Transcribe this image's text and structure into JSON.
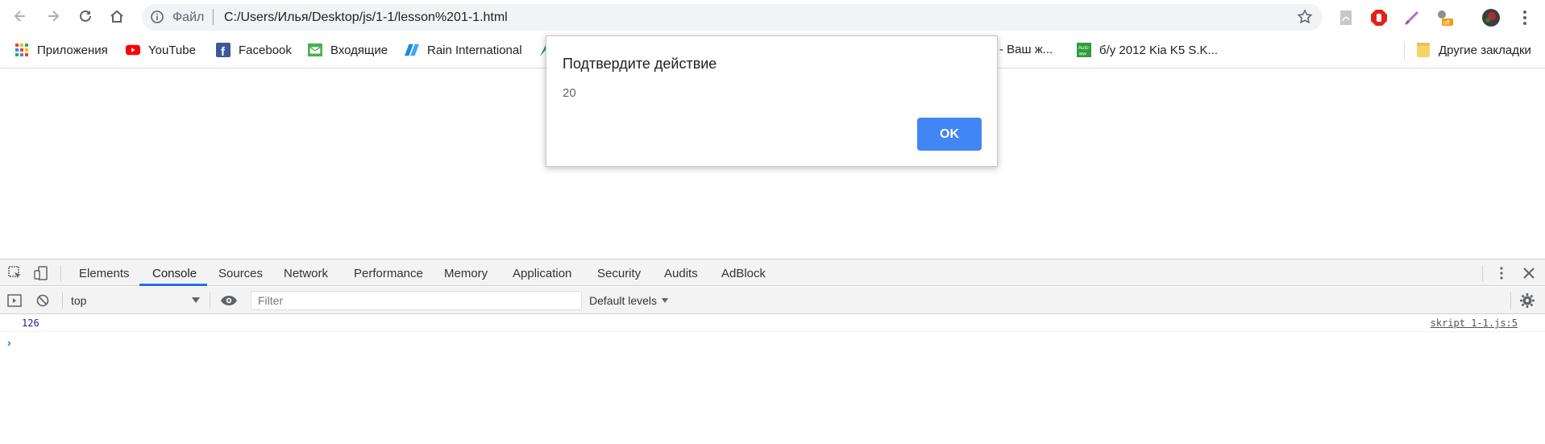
{
  "window": {
    "address": {
      "scheme_label": "Файл",
      "url": "C:/Users/Илья/Desktop/js/1-1/lesson%201-1.html"
    }
  },
  "bookmarks": [
    {
      "label": "Приложения",
      "icon": "apps-grid-icon"
    },
    {
      "label": "YouTube",
      "icon": "youtube-icon"
    },
    {
      "label": "Facebook",
      "icon": "facebook-icon"
    },
    {
      "label": "Входящие",
      "icon": "mail-icon"
    },
    {
      "label": "Rain International",
      "icon": "rain-icon"
    },
    {
      "label": "- Ваш ж...",
      "icon": ""
    },
    {
      "label": "б/у 2012 Kia K5 S.K...",
      "icon": "auto-icon"
    },
    {
      "label": "Другие закладки",
      "icon": "folder-icon"
    }
  ],
  "dialog": {
    "title": "Подтвердите действие",
    "message": "20",
    "ok_label": "OK"
  },
  "devtools": {
    "tabs": [
      "Elements",
      "Console",
      "Sources",
      "Network",
      "Performance",
      "Memory",
      "Application",
      "Security",
      "Audits",
      "AdBlock"
    ],
    "active_tab": "Console",
    "context": "top",
    "filter_placeholder": "Filter",
    "levels_label": "Default levels",
    "messages": [
      {
        "value": "126",
        "source": "skript 1-1.js:5"
      }
    ]
  },
  "colors": {
    "accent": "#1a73e8",
    "dialog_button": "#4285f4",
    "console_number": "#1a1aa6"
  }
}
